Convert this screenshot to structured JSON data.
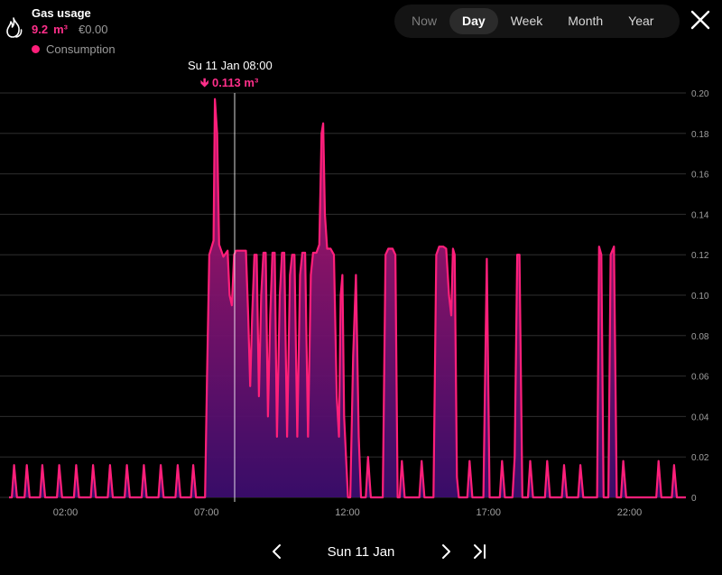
{
  "header": {
    "title": "Gas usage",
    "usage_value": "9.2",
    "usage_unit": "m³",
    "cost": "€0.00",
    "legend_label": "Consumption"
  },
  "tabs": [
    {
      "label": "Now",
      "active": false
    },
    {
      "label": "Day",
      "active": true
    },
    {
      "label": "Week",
      "active": false
    },
    {
      "label": "Month",
      "active": false
    },
    {
      "label": "Year",
      "active": false
    }
  ],
  "tooltip": {
    "date": "Su 11 Jan 08:00",
    "value": "0.113 m³"
  },
  "footer": {
    "date_label": "Sun 11 Jan"
  },
  "colors": {
    "accent": "#ff1f7a",
    "fill_top": "#c2186a",
    "fill_bottom": "#3b0d6e",
    "grid": "#2e2e2e"
  },
  "chart_data": {
    "type": "area",
    "series": [
      {
        "name": "Consumption"
      }
    ],
    "x_tick_labels": [
      "02:00",
      "07:00",
      "12:00",
      "17:00",
      "22:00"
    ],
    "x_tick_hours": [
      2,
      7,
      12,
      17,
      22
    ],
    "y_tick_labels": [
      "0.20",
      "0.18",
      "0.16",
      "0.14",
      "0.12",
      "0.10",
      "0.08",
      "0.06",
      "0.04",
      "0.02",
      "0"
    ],
    "ylim": [
      0,
      0.2
    ],
    "xlim_hours": [
      0,
      24
    ],
    "cursor_hour": 8.0,
    "points": [
      [
        0.0,
        0
      ],
      [
        0.1,
        0
      ],
      [
        0.18,
        0.016
      ],
      [
        0.28,
        0
      ],
      [
        0.55,
        0
      ],
      [
        0.63,
        0.016
      ],
      [
        0.73,
        0
      ],
      [
        1.1,
        0
      ],
      [
        1.18,
        0.016
      ],
      [
        1.28,
        0
      ],
      [
        1.7,
        0
      ],
      [
        1.78,
        0.016
      ],
      [
        1.88,
        0
      ],
      [
        2.3,
        0
      ],
      [
        2.38,
        0.016
      ],
      [
        2.48,
        0
      ],
      [
        2.9,
        0
      ],
      [
        2.98,
        0.016
      ],
      [
        3.08,
        0
      ],
      [
        3.5,
        0
      ],
      [
        3.58,
        0.016
      ],
      [
        3.68,
        0
      ],
      [
        4.1,
        0
      ],
      [
        4.18,
        0.016
      ],
      [
        4.28,
        0
      ],
      [
        4.7,
        0
      ],
      [
        4.78,
        0.016
      ],
      [
        4.88,
        0
      ],
      [
        5.3,
        0
      ],
      [
        5.38,
        0.016
      ],
      [
        5.48,
        0
      ],
      [
        5.9,
        0
      ],
      [
        5.98,
        0.016
      ],
      [
        6.08,
        0
      ],
      [
        6.45,
        0
      ],
      [
        6.53,
        0.016
      ],
      [
        6.63,
        0
      ],
      [
        6.95,
        0
      ],
      [
        7.02,
        0.06
      ],
      [
        7.1,
        0.12
      ],
      [
        7.25,
        0.127
      ],
      [
        7.3,
        0.197
      ],
      [
        7.38,
        0.18
      ],
      [
        7.45,
        0.125
      ],
      [
        7.6,
        0.119
      ],
      [
        7.75,
        0.122
      ],
      [
        7.82,
        0.1
      ],
      [
        7.9,
        0.095
      ],
      [
        7.98,
        0.12
      ],
      [
        8.05,
        0.122
      ],
      [
        8.2,
        0.122
      ],
      [
        8.3,
        0.122
      ],
      [
        8.4,
        0.122
      ],
      [
        8.48,
        0.09
      ],
      [
        8.55,
        0.055
      ],
      [
        8.62,
        0.09
      ],
      [
        8.7,
        0.12
      ],
      [
        8.78,
        0.12
      ],
      [
        8.86,
        0.05
      ],
      [
        8.94,
        0.1
      ],
      [
        9.02,
        0.121
      ],
      [
        9.1,
        0.121
      ],
      [
        9.18,
        0.04
      ],
      [
        9.26,
        0.09
      ],
      [
        9.34,
        0.121
      ],
      [
        9.42,
        0.121
      ],
      [
        9.5,
        0.03
      ],
      [
        9.6,
        0.1
      ],
      [
        9.68,
        0.121
      ],
      [
        9.76,
        0.121
      ],
      [
        9.86,
        0.03
      ],
      [
        9.96,
        0.11
      ],
      [
        10.04,
        0.12
      ],
      [
        10.12,
        0.12
      ],
      [
        10.22,
        0.03
      ],
      [
        10.32,
        0.11
      ],
      [
        10.4,
        0.121
      ],
      [
        10.5,
        0.121
      ],
      [
        10.6,
        0.03
      ],
      [
        10.7,
        0.11
      ],
      [
        10.78,
        0.121
      ],
      [
        10.9,
        0.121
      ],
      [
        11.0,
        0.125
      ],
      [
        11.08,
        0.18
      ],
      [
        11.14,
        0.185
      ],
      [
        11.2,
        0.14
      ],
      [
        11.28,
        0.123
      ],
      [
        11.4,
        0.123
      ],
      [
        11.52,
        0.12
      ],
      [
        11.62,
        0.05
      ],
      [
        11.7,
        0.03
      ],
      [
        11.76,
        0.1
      ],
      [
        11.82,
        0.11
      ],
      [
        11.88,
        0.04
      ],
      [
        11.95,
        0.02
      ],
      [
        12.02,
        0
      ],
      [
        12.1,
        0
      ],
      [
        12.2,
        0.07
      ],
      [
        12.3,
        0.11
      ],
      [
        12.4,
        0.03
      ],
      [
        12.48,
        0
      ],
      [
        12.65,
        0
      ],
      [
        12.73,
        0.02
      ],
      [
        12.83,
        0
      ],
      [
        13.25,
        0
      ],
      [
        13.35,
        0.12
      ],
      [
        13.45,
        0.123
      ],
      [
        13.6,
        0.123
      ],
      [
        13.7,
        0.12
      ],
      [
        13.78,
        0
      ],
      [
        13.85,
        0
      ],
      [
        13.93,
        0.018
      ],
      [
        14.03,
        0
      ],
      [
        14.55,
        0
      ],
      [
        14.63,
        0.018
      ],
      [
        14.73,
        0
      ],
      [
        15.05,
        0
      ],
      [
        15.15,
        0.12
      ],
      [
        15.25,
        0.124
      ],
      [
        15.4,
        0.124
      ],
      [
        15.5,
        0.123
      ],
      [
        15.6,
        0.1
      ],
      [
        15.68,
        0.09
      ],
      [
        15.74,
        0.123
      ],
      [
        15.8,
        0.12
      ],
      [
        15.88,
        0.01
      ],
      [
        15.95,
        0
      ],
      [
        16.25,
        0
      ],
      [
        16.33,
        0.018
      ],
      [
        16.43,
        0
      ],
      [
        16.82,
        0
      ],
      [
        16.94,
        0.118
      ],
      [
        17.04,
        0
      ],
      [
        17.4,
        0
      ],
      [
        17.48,
        0.018
      ],
      [
        17.58,
        0
      ],
      [
        17.85,
        0
      ],
      [
        17.93,
        0.02
      ],
      [
        18.02,
        0.12
      ],
      [
        18.1,
        0.12
      ],
      [
        18.2,
        0
      ],
      [
        18.4,
        0
      ],
      [
        18.48,
        0.018
      ],
      [
        18.58,
        0
      ],
      [
        19.0,
        0
      ],
      [
        19.08,
        0.018
      ],
      [
        19.18,
        0
      ],
      [
        19.6,
        0
      ],
      [
        19.68,
        0.016
      ],
      [
        19.78,
        0
      ],
      [
        20.18,
        0
      ],
      [
        20.26,
        0.016
      ],
      [
        20.36,
        0
      ],
      [
        20.85,
        0
      ],
      [
        20.92,
        0.124
      ],
      [
        21.0,
        0.12
      ],
      [
        21.08,
        0
      ],
      [
        21.25,
        0
      ],
      [
        21.33,
        0.12
      ],
      [
        21.45,
        0.124
      ],
      [
        21.55,
        0
      ],
      [
        21.7,
        0
      ],
      [
        21.78,
        0.018
      ],
      [
        21.88,
        0
      ],
      [
        22.95,
        0
      ],
      [
        23.03,
        0.018
      ],
      [
        23.13,
        0
      ],
      [
        23.5,
        0
      ],
      [
        23.58,
        0.016
      ],
      [
        23.68,
        0
      ],
      [
        24.0,
        0
      ]
    ]
  }
}
